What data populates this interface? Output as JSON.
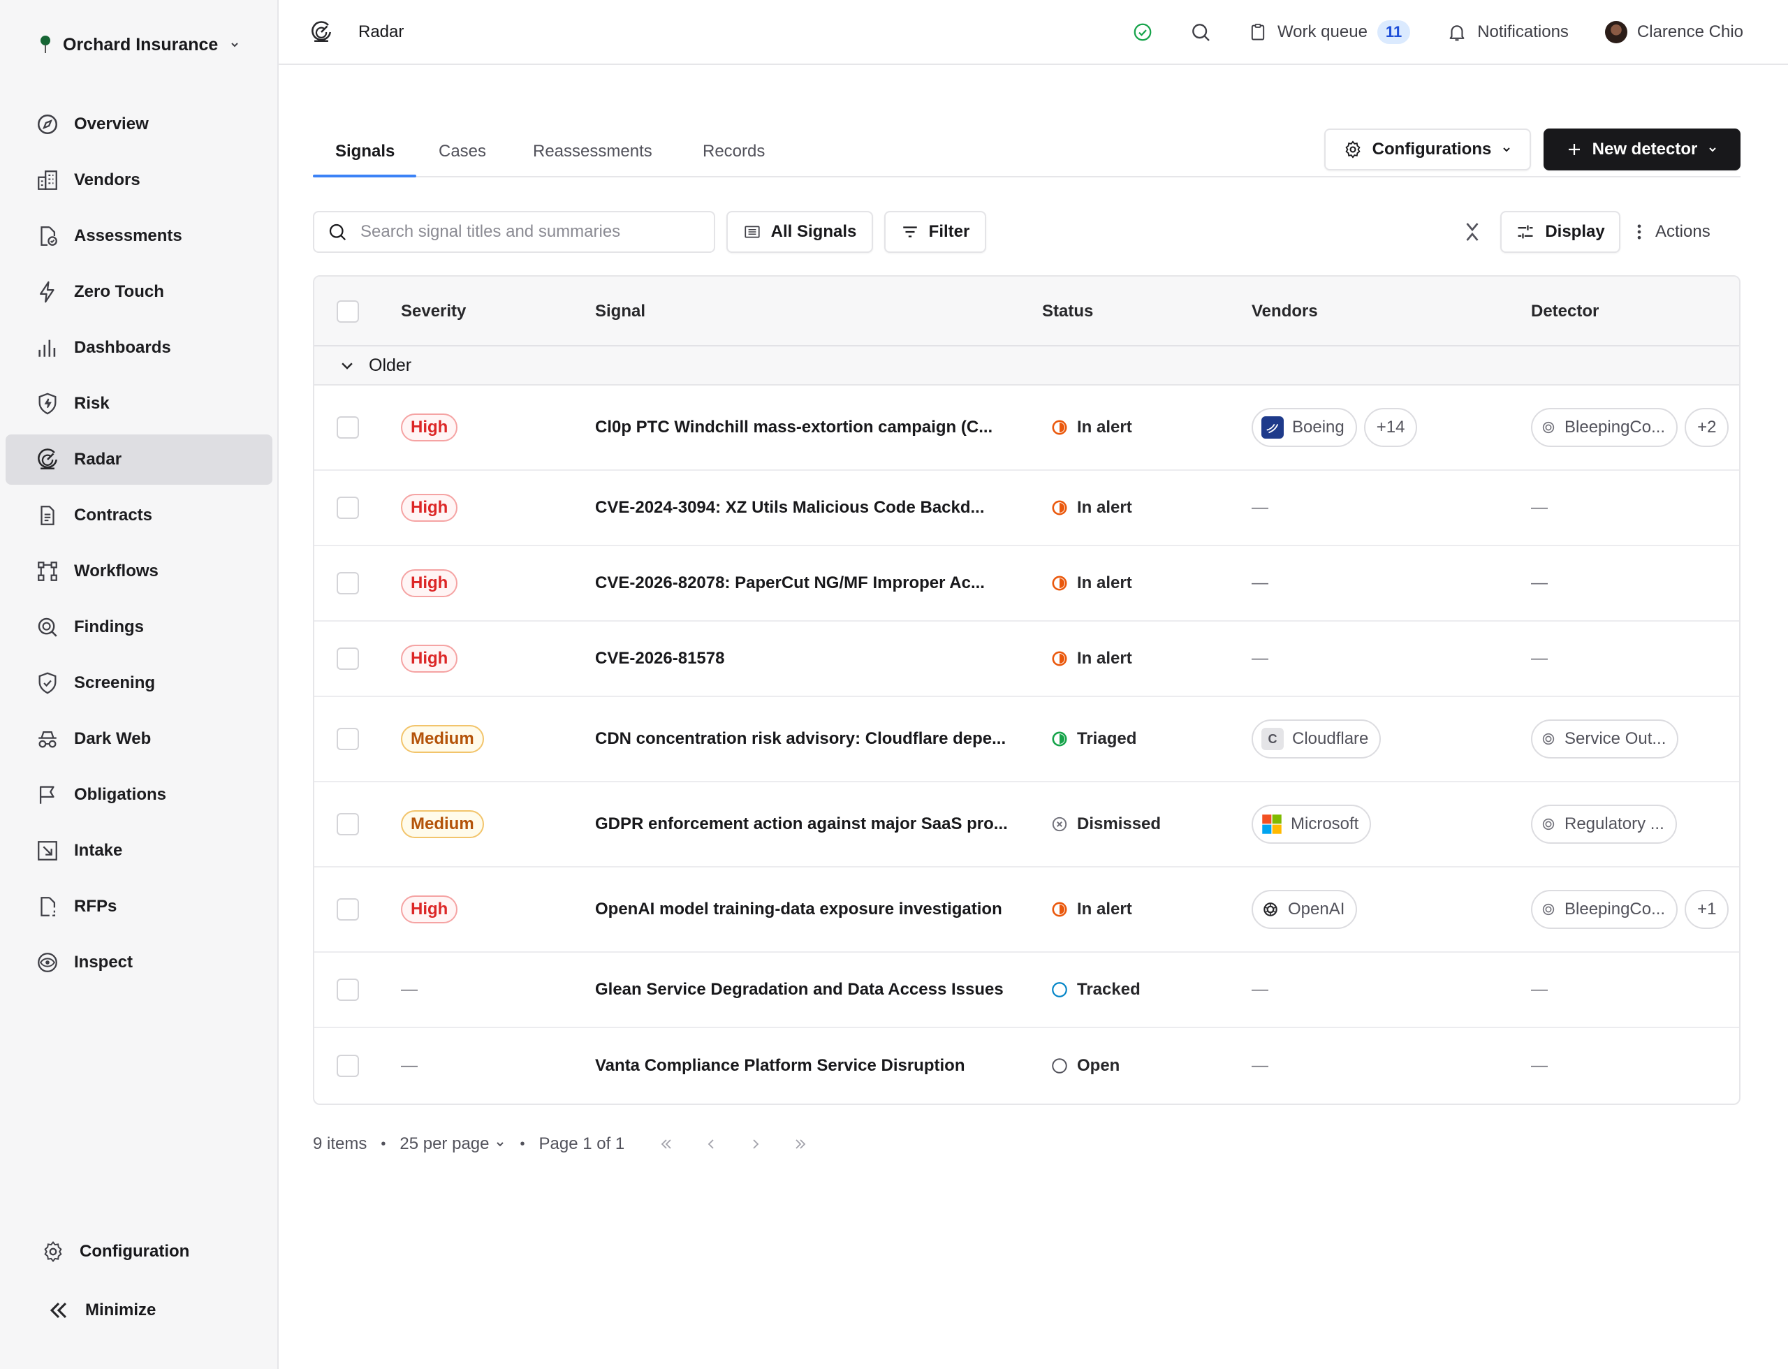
{
  "sidebar": {
    "org_name": "Orchard Insurance",
    "items": [
      {
        "label": "Overview",
        "icon": "compass-icon"
      },
      {
        "label": "Vendors",
        "icon": "building-icon"
      },
      {
        "label": "Assessments",
        "icon": "file-check-icon"
      },
      {
        "label": "Zero Touch",
        "icon": "bolt-icon"
      },
      {
        "label": "Dashboards",
        "icon": "bar-chart-icon"
      },
      {
        "label": "Risk",
        "icon": "shield-bolt-icon"
      },
      {
        "label": "Radar",
        "icon": "radar-icon",
        "active": true
      },
      {
        "label": "Contracts",
        "icon": "document-icon"
      },
      {
        "label": "Workflows",
        "icon": "workflow-icon"
      },
      {
        "label": "Findings",
        "icon": "search-doc-icon"
      },
      {
        "label": "Screening",
        "icon": "shield-check-icon"
      },
      {
        "label": "Dark Web",
        "icon": "spy-icon"
      },
      {
        "label": "Obligations",
        "icon": "flag-icon"
      },
      {
        "label": "Intake",
        "icon": "inbox-arrow-icon"
      },
      {
        "label": "RFPs",
        "icon": "file-dashed-icon"
      },
      {
        "label": "Inspect",
        "icon": "eye-icon"
      }
    ],
    "configuration_label": "Configuration",
    "minimize_label": "Minimize"
  },
  "topbar": {
    "page_title": "Radar",
    "work_queue_label": "Work queue",
    "work_queue_count": "11",
    "notifications_label": "Notifications",
    "user_name": "Clarence Chio"
  },
  "tabs": [
    {
      "label": "Signals",
      "active": true
    },
    {
      "label": "Cases"
    },
    {
      "label": "Reassessments"
    },
    {
      "label": "Records"
    }
  ],
  "buttons": {
    "configurations": "Configurations",
    "new_detector": "New detector",
    "all_signals": "All Signals",
    "filter": "Filter",
    "display": "Display",
    "actions": "Actions"
  },
  "search": {
    "placeholder": "Search signal titles and summaries"
  },
  "table": {
    "columns": {
      "severity": "Severity",
      "signal": "Signal",
      "status": "Status",
      "vendors": "Vendors",
      "detector": "Detector"
    },
    "group_label": "Older",
    "rows": [
      {
        "severity": "High",
        "signal": "Cl0p PTC Windchill mass-extortion campaign (C...",
        "status": "In alert",
        "vendor": "Boeing",
        "vendor_more": "+14",
        "detector": "BleepingCo...",
        "detector_more": "+2"
      },
      {
        "severity": "High",
        "signal": "CVE-2024-3094: XZ Utils Malicious Code Backd...",
        "status": "In alert",
        "vendor": "—",
        "detector": "—"
      },
      {
        "severity": "High",
        "signal": "CVE-2026-82078: PaperCut NG/MF Improper Ac...",
        "status": "In alert",
        "vendor": "—",
        "detector": "—"
      },
      {
        "severity": "High",
        "signal": "CVE-2026-81578",
        "status": "In alert",
        "vendor": "—",
        "detector": "—"
      },
      {
        "severity": "Medium",
        "signal": "CDN concentration risk advisory: Cloudflare depe...",
        "status": "Triaged",
        "vendor": "Cloudflare",
        "detector": "Service Out..."
      },
      {
        "severity": "Medium",
        "signal": "GDPR enforcement action against major SaaS pro...",
        "status": "Dismissed",
        "vendor": "Microsoft",
        "detector": "Regulatory ..."
      },
      {
        "severity": "High",
        "signal": "OpenAI model training-data exposure investigation",
        "status": "In alert",
        "vendor": "OpenAI",
        "detector": "BleepingCo...",
        "detector_more": "+1"
      },
      {
        "severity": "—",
        "signal": "Glean Service Degradation and Data Access Issues",
        "status": "Tracked",
        "vendor": "—",
        "detector": "—"
      },
      {
        "severity": "—",
        "signal": "Vanta Compliance Platform Service Disruption",
        "status": "Open",
        "vendor": "—",
        "detector": "—"
      }
    ]
  },
  "pagination": {
    "items": "9 items",
    "per_page": "25 per page",
    "page": "Page 1 of 1"
  },
  "colors": {
    "accent": "#3b82f6",
    "high": "#dc2626",
    "medium": "#b45309",
    "in_alert": "#ea580c",
    "triaged": "#16a34a",
    "tracked": "#0284c7"
  }
}
